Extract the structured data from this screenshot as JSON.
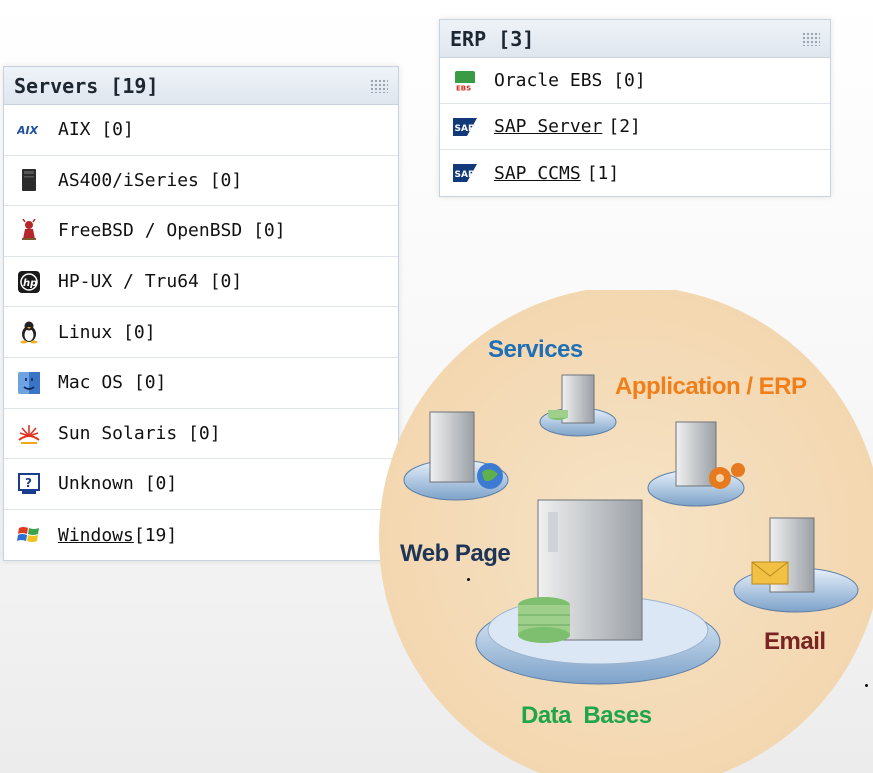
{
  "servers_panel": {
    "title": "Servers [19]",
    "items": [
      {
        "label": "AIX [0]",
        "icon": "aix-icon",
        "linked": false
      },
      {
        "label": "AS400/iSeries [0]",
        "icon": "as400-icon",
        "linked": false
      },
      {
        "label": "FreeBSD / OpenBSD [0]",
        "icon": "bsd-daemon-icon",
        "linked": false
      },
      {
        "label": "HP-UX / Tru64 [0]",
        "icon": "hp-icon",
        "linked": false
      },
      {
        "label": "Linux [0]",
        "icon": "linux-penguin-icon",
        "linked": false
      },
      {
        "label": "Mac OS [0]",
        "icon": "mac-os-icon",
        "linked": false
      },
      {
        "label": "Sun Solaris [0]",
        "icon": "sun-solaris-icon",
        "linked": false
      },
      {
        "label": "Unknown [0]",
        "icon": "unknown-question-icon",
        "linked": false
      },
      {
        "label": "Windows ",
        "count": "[19]",
        "icon": "windows-flag-icon",
        "linked": true
      }
    ]
  },
  "erp_panel": {
    "title": "ERP [3]",
    "items": [
      {
        "label": "Oracle EBS [0]",
        "icon": "ebs-icon",
        "linked": false
      },
      {
        "label": "SAP Server",
        "count": "[2]",
        "icon": "sap-icon",
        "linked": true
      },
      {
        "label": "SAP CCMS",
        "count": "[1]",
        "icon": "sap-icon",
        "linked": true
      }
    ]
  },
  "diagram": {
    "labels": {
      "services": "Services",
      "application": "Application / ERP",
      "web_page": "Web Page",
      "email": "Email",
      "data_bases": "Data  Bases"
    },
    "colors": {
      "circle": "#f5dcb8",
      "services": "#1f6fb7",
      "application": "#f07f1a",
      "web_page": "#1f3557",
      "email": "#7a2323",
      "data_bases": "#1fa64a"
    }
  }
}
